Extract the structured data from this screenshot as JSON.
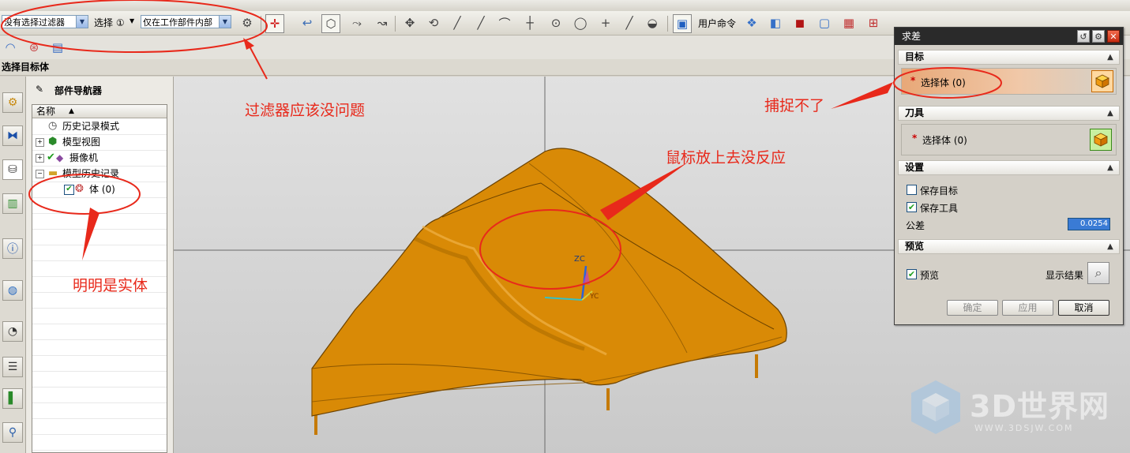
{
  "toolbar": {
    "filter_value": "没有选择过滤器",
    "select_label": "选择 ①",
    "scope_value": "仅在工作部件内部",
    "user_command_label": "用户命令"
  },
  "status_bar": {
    "prompt": "选择目标体"
  },
  "navigator": {
    "title": "部件导航器",
    "column_name": "名称",
    "items": [
      {
        "label": "历史记录模式"
      },
      {
        "label": "模型视图"
      },
      {
        "label": "摄像机"
      },
      {
        "label": "模型历史记录"
      },
      {
        "label": "体 (0)"
      }
    ]
  },
  "viewport": {
    "axis_label_zc": "ZC",
    "axis_label_yc": "YC"
  },
  "dialog": {
    "title": "求差",
    "sections": {
      "target": {
        "title": "目标",
        "select_label": "选择体 (0)",
        "required_mark": "*"
      },
      "tool": {
        "title": "刀具",
        "select_label": "选择体 (0)",
        "required_mark": "*"
      },
      "settings": {
        "title": "设置",
        "keep_target": "保存目标",
        "keep_tool": "保存工具",
        "tolerance_label": "公差",
        "tolerance_value": "0.0254"
      },
      "preview": {
        "title": "预览",
        "preview_label": "预览",
        "show_result_label": "显示结果"
      }
    },
    "checks": {
      "keep_target": false,
      "keep_tool": true,
      "preview": true
    },
    "buttons": {
      "ok": "确定",
      "apply": "应用",
      "cancel": "取消"
    }
  },
  "annotations": {
    "filter_ok": "过滤器应该没问题",
    "cannot_capture": "捕捉不了",
    "no_response": "鼠标放上去没反应",
    "is_solid": "明明是实体"
  },
  "watermark": {
    "brand": "3D世界网",
    "url": "WWW.3DSJW.COM"
  },
  "colors": {
    "model_orange": "#d98a06",
    "annotation_red": "#e8291b",
    "dialog_titlebar": "#2a2a2a"
  }
}
